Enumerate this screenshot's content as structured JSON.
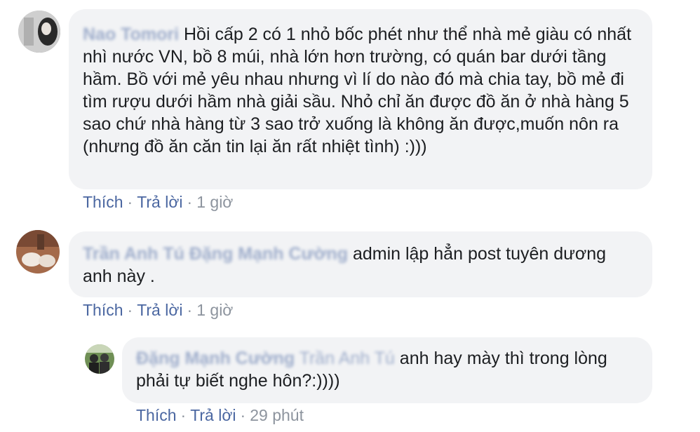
{
  "comments": [
    {
      "author": "Nao Tomori",
      "text": "Hồi cấp 2 có 1 nhỏ bốc phét như thể nhà mẻ giàu có nhất nhì nước VN, bồ 8 múi, nhà lớn hơn trường, có quán bar dưới tầng hầm. Bồ với mẻ yêu nhau nhưng vì lí do nào đó mà chia tay, bồ mẻ đi tìm rượu dưới hầm nhà giải sầu. Nhỏ chỉ ăn được đồ ăn ở nhà hàng 5 sao chứ nhà hàng từ 3 sao trở xuống là không ăn được,muốn nôn ra (nhưng đồ ăn căn tin lại ăn rất nhiệt tình) :)))",
      "like_label": "Thích",
      "reply_label": "Trả lời",
      "time": "1 giờ"
    },
    {
      "author": "Trần Anh Tú Đặng Mạnh Cường",
      "text": "admin lập hẳn post tuyên dương anh này .",
      "like_label": "Thích",
      "reply_label": "Trả lời",
      "time": "1 giờ"
    },
    {
      "author": "Đặng Mạnh Cường",
      "mention": "Trần Anh Tú",
      "text": "anh hay mày thì trong lòng phải tự biết nghe hôn?:))))",
      "like_label": "Thích",
      "reply_label": "Trả lời",
      "time": "29 phút"
    }
  ],
  "separator": "·"
}
